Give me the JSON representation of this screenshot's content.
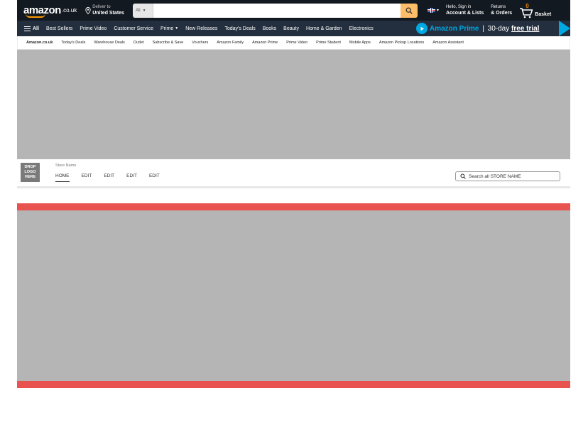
{
  "header": {
    "logo_text": "amazon",
    "logo_tld": ".co.uk",
    "deliver_line1": "Deliver to",
    "deliver_line2": "United States",
    "search_category": "All",
    "account_line1": "Hello, Sign in",
    "account_line2": "Account & Lists",
    "returns_line1": "Returns",
    "returns_line2": "& Orders",
    "basket_count": "0",
    "basket_label": "Basket"
  },
  "main_nav": {
    "all_label": "All",
    "items": [
      "Best Sellers",
      "Prime Video",
      "Customer Service",
      "Prime",
      "New Releases",
      "Today's Deals",
      "Books",
      "Beauty",
      "Home & Garden",
      "Electronics"
    ],
    "prime_banner": {
      "brand": "Amazon Prime",
      "separator": "|",
      "days": "30-day",
      "free": "free trial"
    }
  },
  "sub_nav": {
    "items": [
      "Amazon.co.uk",
      "Today's Deals",
      "Warehouse Deals",
      "Outlet",
      "Subscribe & Save",
      "Vouchers",
      "Amazon Family",
      "Amazon Prime",
      "Prime Video",
      "Prime Student",
      "Mobile Apps",
      "Amazon Pickup Locations",
      "Amazon Assistant"
    ]
  },
  "store": {
    "logo_placeholder": "DROP LOGO HERE",
    "store_name": "Store Name",
    "tabs": [
      "HOME",
      "EDIT",
      "EDIT",
      "EDIT",
      "EDIT"
    ],
    "search_placeholder": "Search all STORE NAME"
  },
  "colors": {
    "nav_dark": "#131921",
    "nav_main": "#232f3e",
    "accent_orange": "#febd69",
    "prime_blue": "#00a8e1",
    "placeholder_gray": "#b5b5b5",
    "band_red": "#e9534f"
  }
}
